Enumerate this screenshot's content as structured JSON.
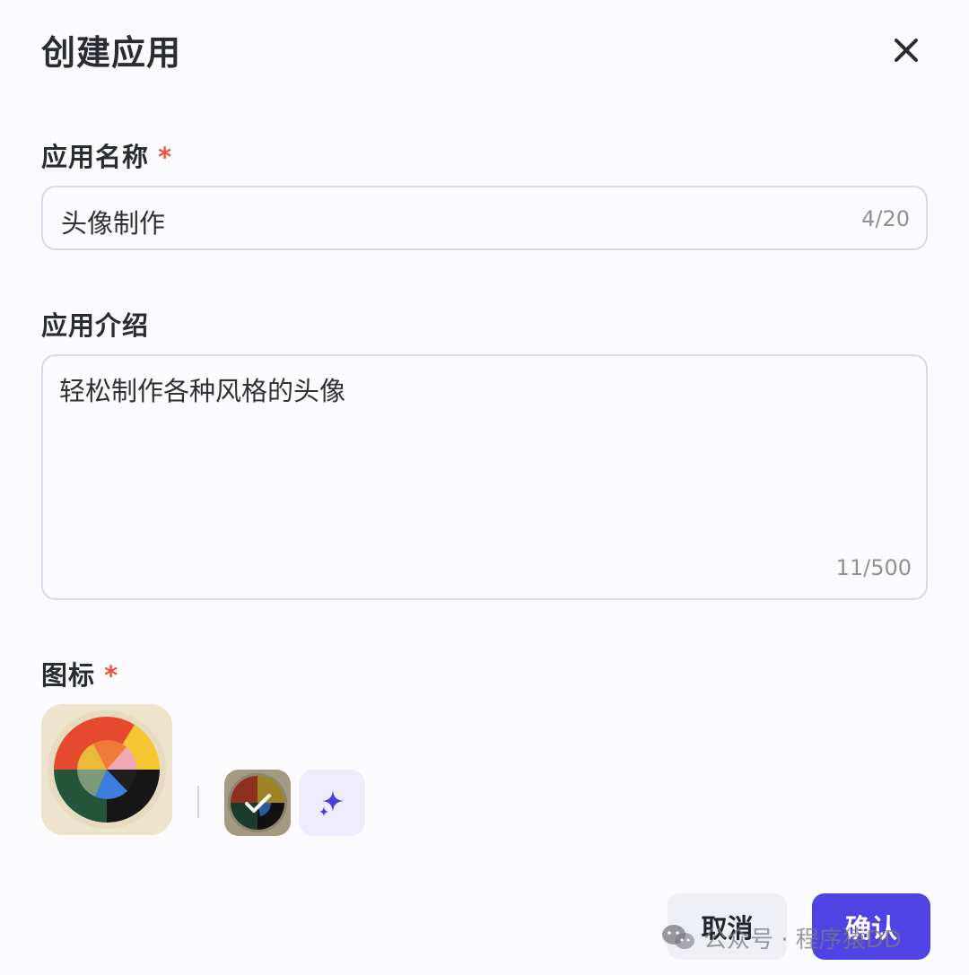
{
  "dialog": {
    "title": "创建应用",
    "close_icon": "close-icon"
  },
  "name_field": {
    "label": "应用名称",
    "required_mark": "*",
    "value": "头像制作",
    "count": "4/20"
  },
  "desc_field": {
    "label": "应用介绍",
    "value": "轻松制作各种风格的头像",
    "count": "11/500"
  },
  "icon_field": {
    "label": "图标",
    "required_mark": "*",
    "preview_icon": "color-wheel-avatar-icon",
    "selected_icon": "color-wheel-avatar-icon",
    "selected_check_icon": "check-icon",
    "ai_generate_icon": "sparkle-icon"
  },
  "footer": {
    "cancel_label": "取消",
    "confirm_label": "确认"
  },
  "watermark": {
    "text": "公众号 · 程序猿DD",
    "icon": "wechat-icon"
  },
  "colors": {
    "accent": "#5042e3",
    "required": "#e8553b",
    "border": "#d9d8e6"
  }
}
